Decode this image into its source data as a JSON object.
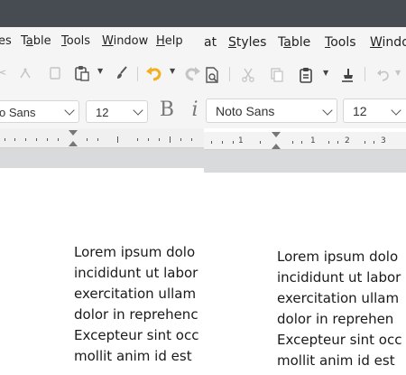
{
  "left": {
    "menu": [
      {
        "label": "es",
        "underline": ""
      },
      {
        "label": "Table",
        "underline": "a"
      },
      {
        "label": "Tools",
        "underline": "T"
      },
      {
        "label": "Window",
        "underline": "W"
      },
      {
        "label": "Help",
        "underline": "H"
      }
    ],
    "font_name": "o Sans",
    "font_size": "12",
    "bold_icon_glyph": "B",
    "italic_icon_glyph": "i",
    "document_lines": [
      "Lorem ipsum dolo",
      "incididunt ut labor",
      "exercitation ullam",
      "dolor in reprehenc",
      "Excepteur sint occ",
      "mollit anim id est"
    ]
  },
  "right": {
    "menu": [
      {
        "label": "at",
        "underline": ""
      },
      {
        "label": "Styles",
        "underline": "S"
      },
      {
        "label": "Table",
        "underline": "a"
      },
      {
        "label": "Tools",
        "underline": "T"
      },
      {
        "label": "Windo",
        "underline": "W"
      }
    ],
    "font_name": "Noto Sans",
    "font_size": "12",
    "ruler_numbers": [
      "1",
      "1",
      "2",
      "3"
    ],
    "document_lines": [
      "Lorem ipsum dolo",
      "incididunt ut labor",
      "exercitation ullam",
      "dolor in reprehen",
      "Excepteur sint occ",
      "mollit anim id est"
    ]
  },
  "colors": {
    "titlebar": "#474b52",
    "toolbar_bg": "#f5f5f5",
    "undo_accent": "#f0b020",
    "workspace_gray": "#d9dadb"
  },
  "icons": {
    "left_toolbar": [
      "clone-formatting-icon",
      "paste-icon",
      "paint-brush-icon",
      "undo-icon",
      "redo-icon",
      "print-preview-icon"
    ],
    "right_toolbar": [
      "cut-icon",
      "copy-icon",
      "paste-icon",
      "clear-formatting-icon",
      "undo-icon"
    ]
  }
}
